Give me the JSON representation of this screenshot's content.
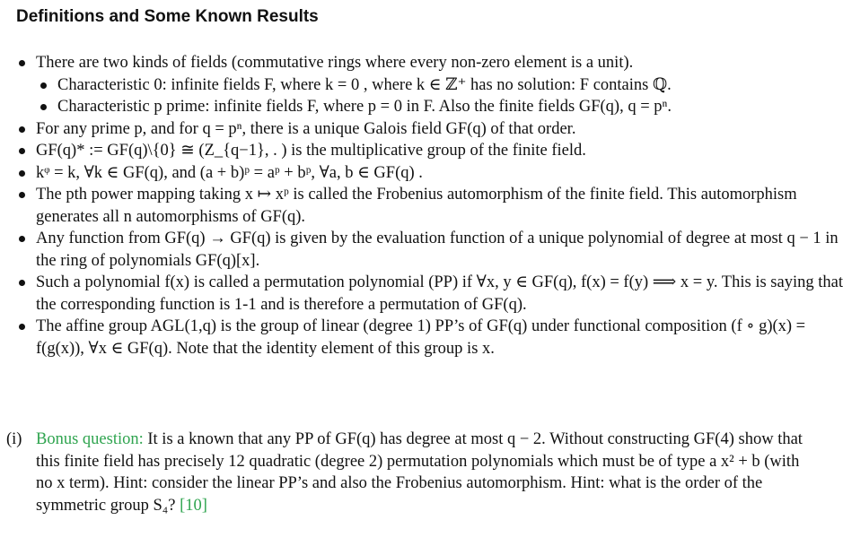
{
  "heading": "Definitions and Some Known Results",
  "bullets": [
    {
      "level": 1,
      "text": "There are two kinds of fields (commutative rings where every non-zero element is a unit)."
    },
    {
      "level": 2,
      "text": "Characteristic 0: infinite fields F, where k = 0 , where k ∈ ℤ⁺ has no solution: F contains ℚ."
    },
    {
      "level": 2,
      "text": "Characteristic p prime: infinite fields F, where p = 0 in F. Also the finite fields GF(q), q = pⁿ."
    },
    {
      "level": 1,
      "text": "For any prime p, and for q = pⁿ,  there is a unique Galois field GF(q) of that order."
    },
    {
      "level": 1,
      "text": "GF(q)* := GF(q)\\{0} ≅ (Z_{q−1}, . ) is the multiplicative group of the finite field."
    },
    {
      "level": 1,
      "text": "kᵠ = k, ∀k ∈ GF(q), and (a + b)ᵖ = aᵖ + bᵖ, ∀a, b ∈ GF(q) ."
    },
    {
      "level": 1,
      "text": "The pth power mapping taking x ↦ xᵖ is called the Frobenius automorphism of the finite field.  This automorphism generates all n automorphisms of GF(q)."
    },
    {
      "level": 1,
      "text": "Any function from GF(q) → GF(q) is given by the evaluation function of a unique polynomial of degree at most q − 1 in the ring of polynomials GF(q)[x]."
    },
    {
      "level": 1,
      "text": "Such a polynomial f(x) is called a permutation polynomial (PP) if ∀x, y ∈ GF(q), f(x) = f(y)  ⟹  x = y. This is saying that the corresponding function is 1-1 and is therefore a permutation of GF(q)."
    },
    {
      "level": 1,
      "text": "The affine group AGL(1,q) is the group of linear (degree 1) PP’s of GF(q) under functional composition (f ∘ g)(x) = f(g(x)), ∀x ∈ GF(q).  Note that the identity element of this group is x."
    }
  ],
  "question": {
    "number": "(i)",
    "label": "Bonus question:",
    "text": "It is a known that any PP of GF(q) has degree at most q − 2. Without constructing GF(4) show that this finite field has precisely 12 quadratic (degree 2) permutation polynomials which must be of type a x² + b (with no x term).  Hint: consider the linear PP’s and also the Frobenius automorphism. Hint: what is the order of the symmetric group S₄?",
    "marks": "[10]"
  },
  "colors": {
    "accent_green": "#2fa44f",
    "text": "#111111"
  }
}
